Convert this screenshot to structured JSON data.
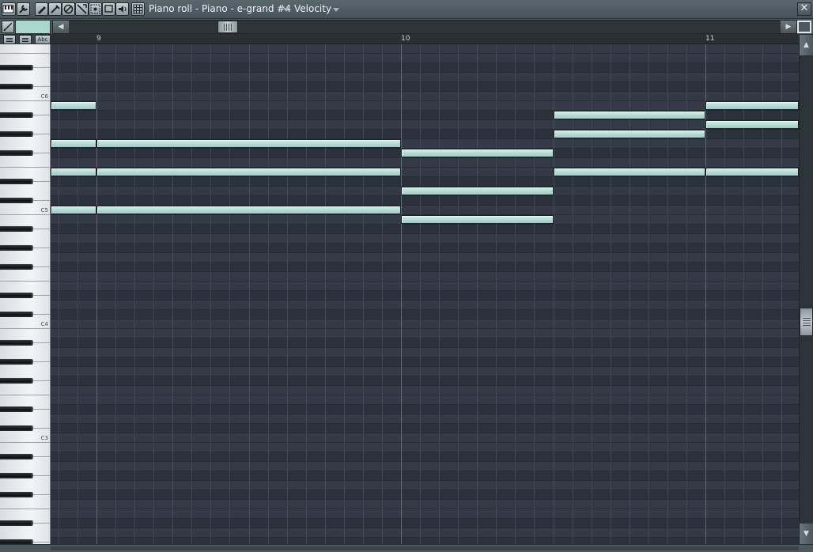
{
  "window": {
    "title": "Piano roll - Piano - e-grand #4",
    "target": "Velocity",
    "close_glyph": "✕"
  },
  "toolbar": {
    "tools": [
      "piano-menu",
      "wrench",
      "draw",
      "paint",
      "delete",
      "mute",
      "slice",
      "select",
      "zoom",
      "playback",
      "snap-grid"
    ]
  },
  "view": {
    "abc_label": "Abc",
    "scroll_left": "◀",
    "scroll_right": "▶",
    "scroll_up": "▲",
    "scroll_down": "▼"
  },
  "timeline": {
    "bars": [
      {
        "label": "9"
      },
      {
        "label": "10"
      },
      {
        "label": "11"
      }
    ]
  },
  "keyboard": {
    "octave_labels": [
      "C6",
      "C5",
      "C4",
      "C3"
    ]
  },
  "colors": {
    "note": "#b7ddd5",
    "grid_bg": "#343b47",
    "swatch": "#a9d6cd"
  },
  "notes": [
    {
      "pitch": "B5",
      "start_beats": 0,
      "length_beats": 0.6
    },
    {
      "pitch": "G5",
      "start_beats": 0,
      "length_beats": 0.6
    },
    {
      "pitch": "G5",
      "start_beats": 0.6,
      "length_beats": 4
    },
    {
      "pitch": "E5",
      "start_beats": 0,
      "length_beats": 0.6
    },
    {
      "pitch": "E5",
      "start_beats": 0.6,
      "length_beats": 4
    },
    {
      "pitch": "C5",
      "start_beats": 0,
      "length_beats": 0.6
    },
    {
      "pitch": "C5",
      "start_beats": 0.6,
      "length_beats": 4
    },
    {
      "pitch": "F#5",
      "start_beats": 4.6,
      "length_beats": 2
    },
    {
      "pitch": "D5",
      "start_beats": 4.6,
      "length_beats": 2
    },
    {
      "pitch": "B4",
      "start_beats": 4.6,
      "length_beats": 2
    },
    {
      "pitch": "A#5",
      "start_beats": 6.6,
      "length_beats": 2
    },
    {
      "pitch": "G#5",
      "start_beats": 6.6,
      "length_beats": 2
    },
    {
      "pitch": "E5",
      "start_beats": 6.6,
      "length_beats": 2
    },
    {
      "pitch": "B5",
      "start_beats": 8.6,
      "length_beats": 1.25
    },
    {
      "pitch": "A5",
      "start_beats": 8.6,
      "length_beats": 1.25
    },
    {
      "pitch": "E5",
      "start_beats": 8.6,
      "length_beats": 1.25
    }
  ]
}
